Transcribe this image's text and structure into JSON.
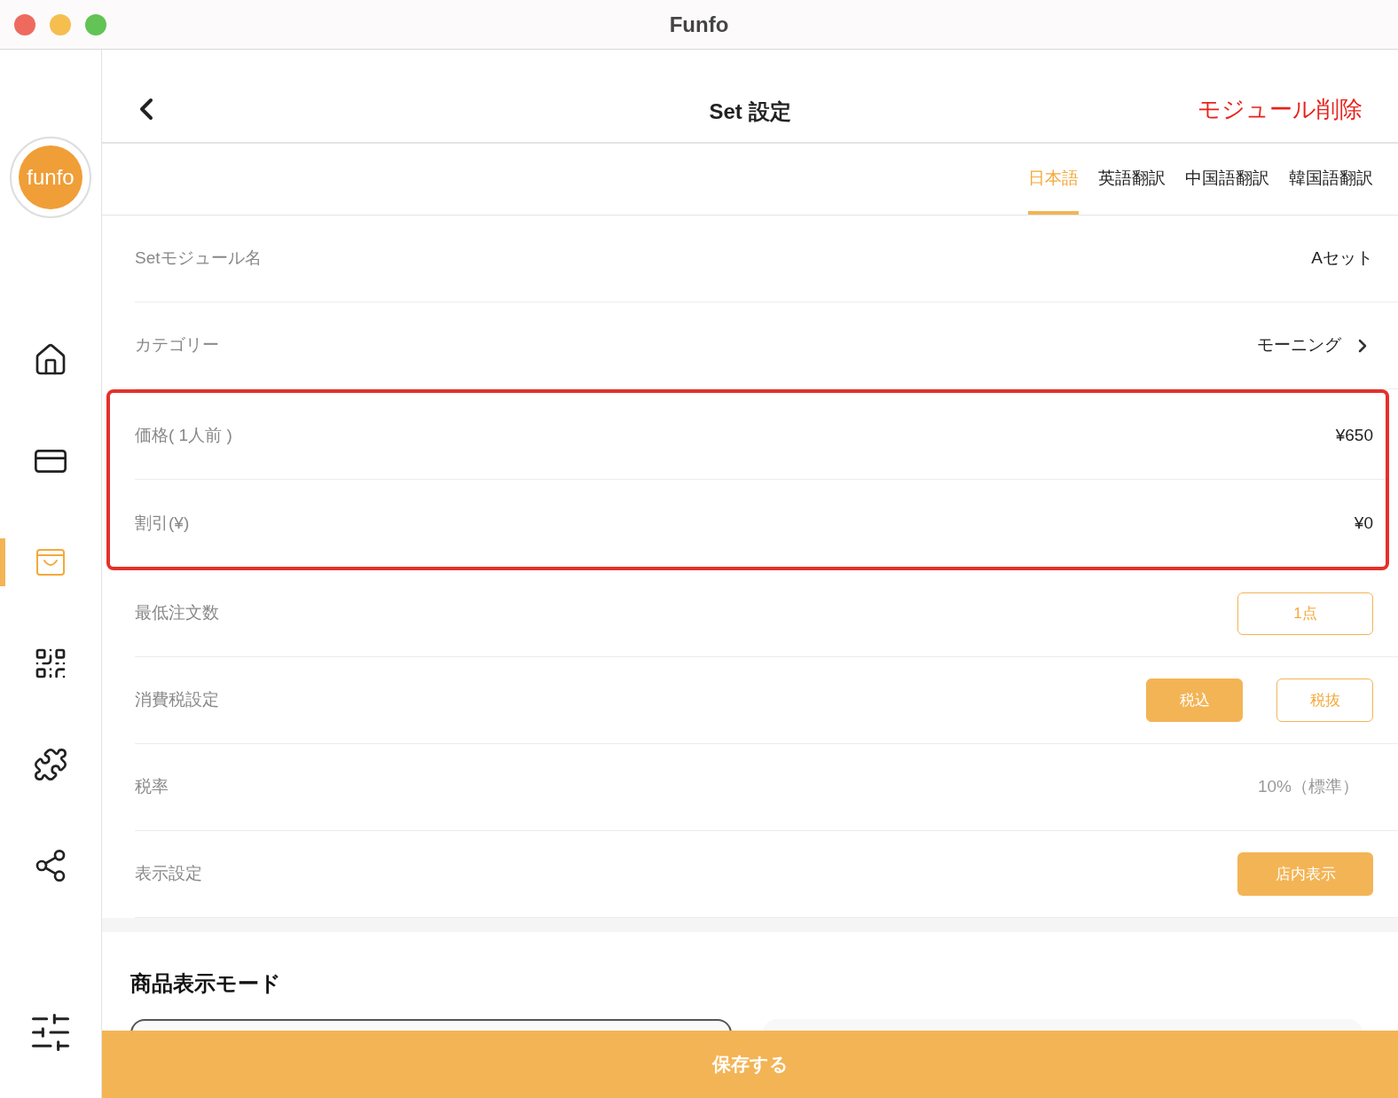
{
  "window": {
    "title": "Funfo"
  },
  "sidebar": {
    "logo": "funfo",
    "items": [
      {
        "selected": false
      },
      {
        "selected": false
      },
      {
        "selected": true
      },
      {
        "selected": false
      },
      {
        "selected": false
      },
      {
        "selected": false
      }
    ]
  },
  "header": {
    "title": "Set 設定",
    "action": "モジュール削除"
  },
  "tabs": [
    {
      "label": "日本語",
      "selected": true
    },
    {
      "label": "英語翻訳",
      "selected": false
    },
    {
      "label": "中国語翻訳",
      "selected": false
    },
    {
      "label": "韓国語翻訳",
      "selected": false
    }
  ],
  "rows": [
    {
      "kind": "text",
      "label": "Setモジュール名",
      "value": "Aセット",
      "highlighted": false
    },
    {
      "kind": "link",
      "label": "カテゴリー",
      "value": "モーニング",
      "highlighted": false
    },
    {
      "kind": "text",
      "label": "価格( 1人前 )",
      "value": "¥650",
      "highlighted": true
    },
    {
      "kind": "text",
      "label": "割引(¥)",
      "value": "¥0",
      "highlighted": true
    },
    {
      "kind": "field",
      "label": "最低注文数",
      "value": "1点",
      "highlighted": false
    },
    {
      "kind": "choice",
      "label": "消費税設定",
      "options": [
        {
          "label": "税込",
          "selected": true
        },
        {
          "label": "税抜",
          "selected": false
        }
      ],
      "highlighted": false
    },
    {
      "kind": "muted",
      "label": "税率",
      "value": "10%（標準）",
      "highlighted": false
    },
    {
      "kind": "button",
      "label": "表示設定",
      "value": "店内表示",
      "highlighted": false
    }
  ],
  "section": {
    "title": "商品表示モード"
  },
  "save_button": "保存する"
}
